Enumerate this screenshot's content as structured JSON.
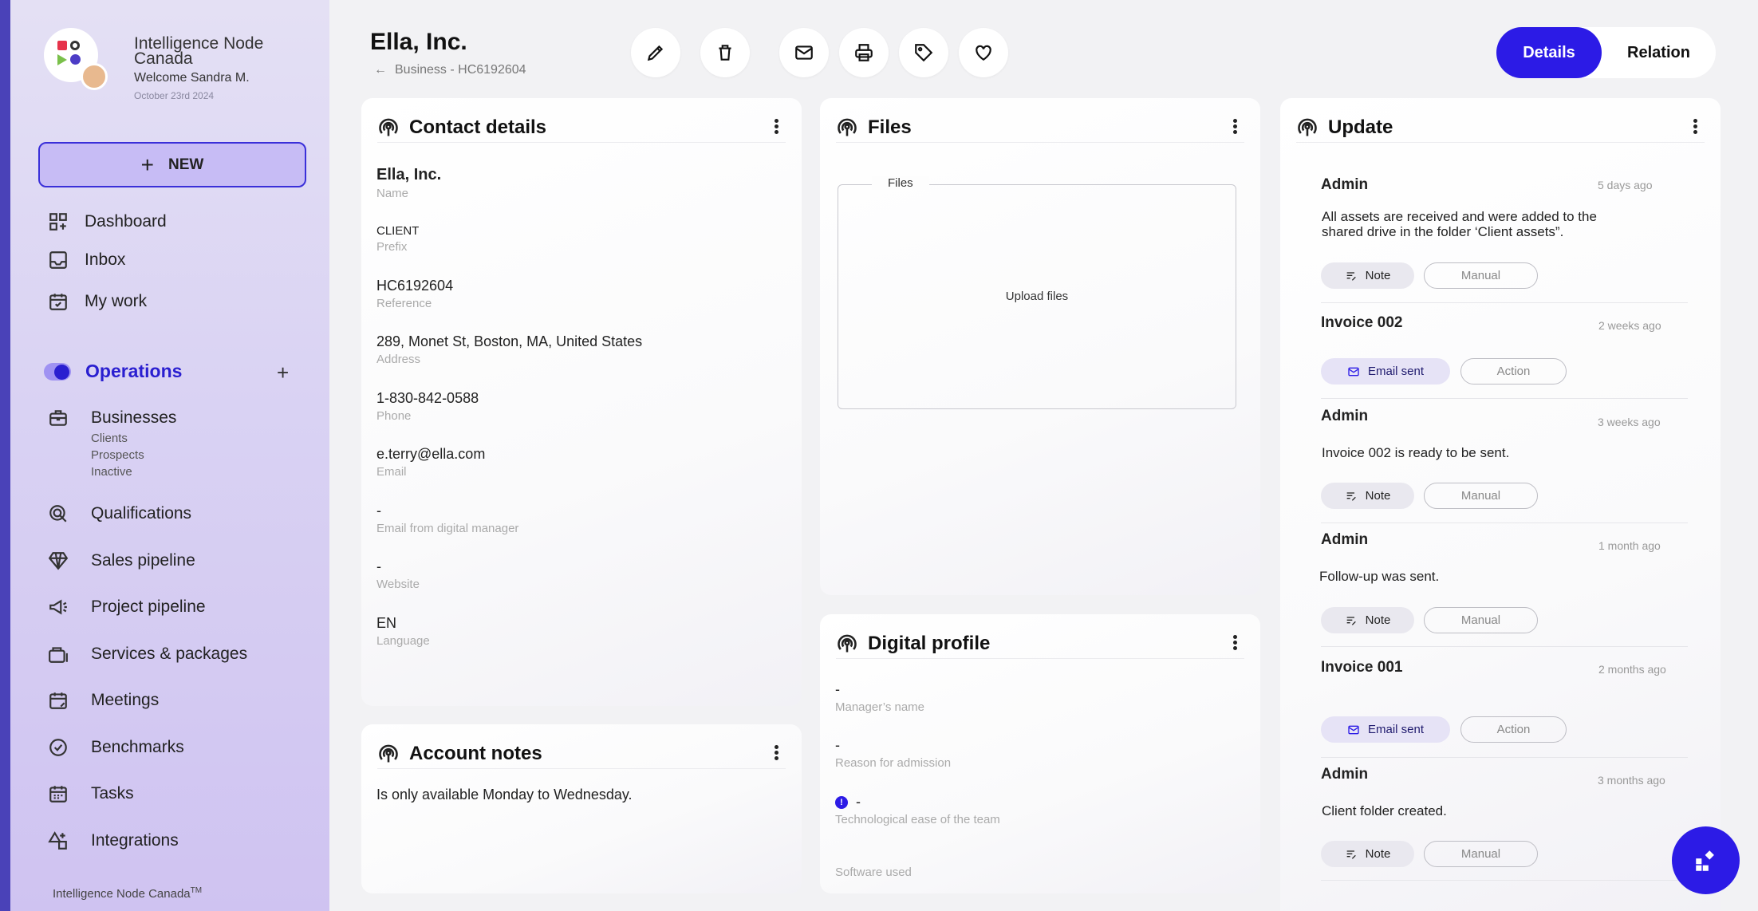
{
  "sidebar": {
    "org_name": "Intelligence Node Canada",
    "welcome": "Welcome Sandra M.",
    "date": "October 23rd 2024",
    "new_label": "NEW",
    "top_items": [
      {
        "label": "Dashboard",
        "icon": "dashboard-icon"
      },
      {
        "label": "Inbox",
        "icon": "inbox-icon"
      },
      {
        "label": "My work",
        "icon": "calendar-check-icon"
      }
    ],
    "section_label": "Operations",
    "businesses_label": "Businesses",
    "business_sub": [
      "Clients",
      "Prospects",
      "Inactive"
    ],
    "items": [
      {
        "label": "Qualifications",
        "icon": "qualification-icon"
      },
      {
        "label": "Sales pipeline",
        "icon": "diamond-icon"
      },
      {
        "label": "Project pipeline",
        "icon": "megaphone-icon"
      },
      {
        "label": "Services & packages",
        "icon": "briefcase-stack-icon"
      },
      {
        "label": "Meetings",
        "icon": "calendar-edit-icon"
      },
      {
        "label": "Benchmarks",
        "icon": "badge-check-icon"
      },
      {
        "label": "Tasks",
        "icon": "calendar-icon"
      },
      {
        "label": "Integrations",
        "icon": "shapes-icon"
      }
    ],
    "footer": "Intelligence Node Canada",
    "footer_mark": "TM"
  },
  "header": {
    "title": "Ella, Inc.",
    "breadcrumb": "Business - HC6192604",
    "toggle": {
      "active": "Details",
      "inactive": "Relation"
    }
  },
  "contact": {
    "title": "Contact details",
    "fields": [
      {
        "value": "Ella, Inc.",
        "label": "Name"
      },
      {
        "value": "CLIENT",
        "label": "Prefix"
      },
      {
        "value": "HC6192604",
        "label": "Reference"
      },
      {
        "value": "289, Monet St, Boston, MA, United States",
        "label": "Address"
      },
      {
        "value": "1-830-842-0588",
        "label": "Phone"
      },
      {
        "value": "e.terry@ella.com",
        "label": "Email"
      },
      {
        "value": "-",
        "label": "Email from digital manager"
      },
      {
        "value": "-",
        "label": "Website"
      },
      {
        "value": "EN",
        "label": "Language"
      }
    ]
  },
  "notes": {
    "title": "Account notes",
    "text": "Is only available Monday to Wednesday."
  },
  "files": {
    "title": "Files",
    "legend": "Files",
    "upload_label": "Upload files"
  },
  "digital": {
    "title": "Digital profile",
    "fields": [
      {
        "value": "-",
        "label": "Manager’s name"
      },
      {
        "value": "-",
        "label": "Reason for admission"
      },
      {
        "value": "-",
        "label": "Technological ease of the team"
      },
      {
        "value": "",
        "label": "Software used"
      }
    ]
  },
  "update": {
    "title": "Update",
    "entries": [
      {
        "author": "Admin",
        "time": "5 days ago",
        "text": "All assets are received and were added to the shared drive in the folder ‘Client assets”.",
        "tag": "Note",
        "type": "Manual"
      },
      {
        "author": "Invoice 002",
        "time": "2 weeks ago",
        "text": "",
        "tag": "Email sent",
        "type": "Action"
      },
      {
        "author": "Admin",
        "time": "3 weeks ago",
        "text": "Invoice 002 is ready to be sent.",
        "tag": "Note",
        "type": "Manual"
      },
      {
        "author": "Admin",
        "time": "1 month ago",
        "text": "Follow-up was sent.",
        "tag": "Note",
        "type": "Manual"
      },
      {
        "author": "Invoice 001",
        "time": "2 months ago",
        "text": "",
        "tag": "Email sent",
        "type": "Action"
      },
      {
        "author": "Admin",
        "time": "3 months ago",
        "text": "Client folder created.",
        "tag": "Note",
        "type": "Manual"
      }
    ]
  },
  "colors": {
    "accent": "#2c1be6",
    "sidebar": "#d9d2f3",
    "edge": "#4a42b8"
  }
}
